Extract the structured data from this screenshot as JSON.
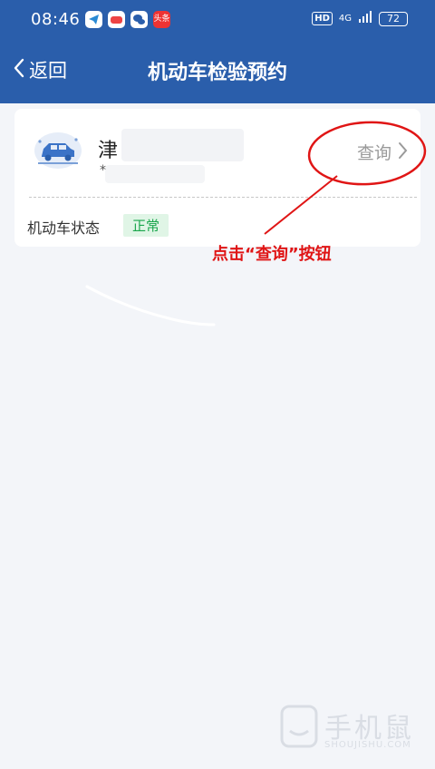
{
  "status_bar": {
    "time": "08:46",
    "app_icons": [
      "telegram-icon",
      "game-icon",
      "wechat-icon",
      "toutiao-icon"
    ],
    "app_icon_text": "头条",
    "hd": "HD",
    "network": "4G",
    "battery": "72"
  },
  "header": {
    "back_label": "返回",
    "title": "机动车检验预约"
  },
  "vehicle_card": {
    "plate_prefix": "津",
    "plate_sub": "*",
    "query_label": "查询",
    "status_label": "机动车状态",
    "status_value": "正常"
  },
  "annotation": {
    "text": "点击“查询”按钮"
  },
  "watermark": {
    "text": "手机鼠",
    "sub": "SHOUJISHU.COM"
  },
  "colors": {
    "header_bg": "#2a5eab",
    "annotation_red": "#e01515",
    "status_green": "#1aa64c"
  }
}
